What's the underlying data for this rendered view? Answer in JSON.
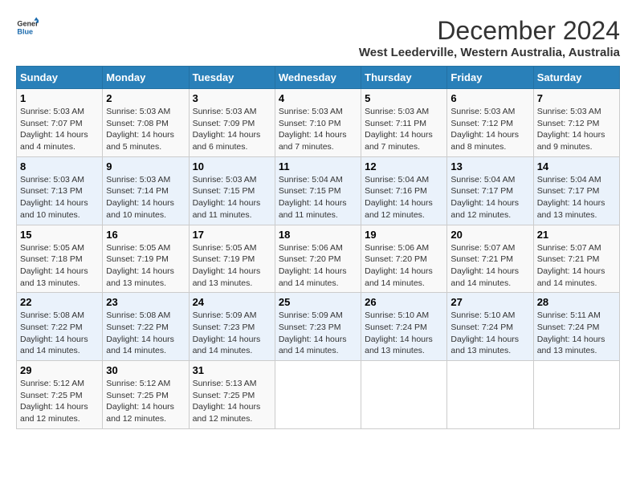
{
  "logo": {
    "line1": "General",
    "line2": "Blue"
  },
  "title": "December 2024",
  "subtitle": "West Leederville, Western Australia, Australia",
  "days_of_week": [
    "Sunday",
    "Monday",
    "Tuesday",
    "Wednesday",
    "Thursday",
    "Friday",
    "Saturday"
  ],
  "weeks": [
    [
      {
        "day": "1",
        "sunrise": "5:03 AM",
        "sunset": "7:07 PM",
        "daylight": "14 hours and 4 minutes."
      },
      {
        "day": "2",
        "sunrise": "5:03 AM",
        "sunset": "7:08 PM",
        "daylight": "14 hours and 5 minutes."
      },
      {
        "day": "3",
        "sunrise": "5:03 AM",
        "sunset": "7:09 PM",
        "daylight": "14 hours and 6 minutes."
      },
      {
        "day": "4",
        "sunrise": "5:03 AM",
        "sunset": "7:10 PM",
        "daylight": "14 hours and 7 minutes."
      },
      {
        "day": "5",
        "sunrise": "5:03 AM",
        "sunset": "7:11 PM",
        "daylight": "14 hours and 7 minutes."
      },
      {
        "day": "6",
        "sunrise": "5:03 AM",
        "sunset": "7:12 PM",
        "daylight": "14 hours and 8 minutes."
      },
      {
        "day": "7",
        "sunrise": "5:03 AM",
        "sunset": "7:12 PM",
        "daylight": "14 hours and 9 minutes."
      }
    ],
    [
      {
        "day": "8",
        "sunrise": "5:03 AM",
        "sunset": "7:13 PM",
        "daylight": "14 hours and 10 minutes."
      },
      {
        "day": "9",
        "sunrise": "5:03 AM",
        "sunset": "7:14 PM",
        "daylight": "14 hours and 10 minutes."
      },
      {
        "day": "10",
        "sunrise": "5:03 AM",
        "sunset": "7:15 PM",
        "daylight": "14 hours and 11 minutes."
      },
      {
        "day": "11",
        "sunrise": "5:04 AM",
        "sunset": "7:15 PM",
        "daylight": "14 hours and 11 minutes."
      },
      {
        "day": "12",
        "sunrise": "5:04 AM",
        "sunset": "7:16 PM",
        "daylight": "14 hours and 12 minutes."
      },
      {
        "day": "13",
        "sunrise": "5:04 AM",
        "sunset": "7:17 PM",
        "daylight": "14 hours and 12 minutes."
      },
      {
        "day": "14",
        "sunrise": "5:04 AM",
        "sunset": "7:17 PM",
        "daylight": "14 hours and 13 minutes."
      }
    ],
    [
      {
        "day": "15",
        "sunrise": "5:05 AM",
        "sunset": "7:18 PM",
        "daylight": "14 hours and 13 minutes."
      },
      {
        "day": "16",
        "sunrise": "5:05 AM",
        "sunset": "7:19 PM",
        "daylight": "14 hours and 13 minutes."
      },
      {
        "day": "17",
        "sunrise": "5:05 AM",
        "sunset": "7:19 PM",
        "daylight": "14 hours and 13 minutes."
      },
      {
        "day": "18",
        "sunrise": "5:06 AM",
        "sunset": "7:20 PM",
        "daylight": "14 hours and 14 minutes."
      },
      {
        "day": "19",
        "sunrise": "5:06 AM",
        "sunset": "7:20 PM",
        "daylight": "14 hours and 14 minutes."
      },
      {
        "day": "20",
        "sunrise": "5:07 AM",
        "sunset": "7:21 PM",
        "daylight": "14 hours and 14 minutes."
      },
      {
        "day": "21",
        "sunrise": "5:07 AM",
        "sunset": "7:21 PM",
        "daylight": "14 hours and 14 minutes."
      }
    ],
    [
      {
        "day": "22",
        "sunrise": "5:08 AM",
        "sunset": "7:22 PM",
        "daylight": "14 hours and 14 minutes."
      },
      {
        "day": "23",
        "sunrise": "5:08 AM",
        "sunset": "7:22 PM",
        "daylight": "14 hours and 14 minutes."
      },
      {
        "day": "24",
        "sunrise": "5:09 AM",
        "sunset": "7:23 PM",
        "daylight": "14 hours and 14 minutes."
      },
      {
        "day": "25",
        "sunrise": "5:09 AM",
        "sunset": "7:23 PM",
        "daylight": "14 hours and 14 minutes."
      },
      {
        "day": "26",
        "sunrise": "5:10 AM",
        "sunset": "7:24 PM",
        "daylight": "14 hours and 13 minutes."
      },
      {
        "day": "27",
        "sunrise": "5:10 AM",
        "sunset": "7:24 PM",
        "daylight": "14 hours and 13 minutes."
      },
      {
        "day": "28",
        "sunrise": "5:11 AM",
        "sunset": "7:24 PM",
        "daylight": "14 hours and 13 minutes."
      }
    ],
    [
      {
        "day": "29",
        "sunrise": "5:12 AM",
        "sunset": "7:25 PM",
        "daylight": "14 hours and 12 minutes."
      },
      {
        "day": "30",
        "sunrise": "5:12 AM",
        "sunset": "7:25 PM",
        "daylight": "14 hours and 12 minutes."
      },
      {
        "day": "31",
        "sunrise": "5:13 AM",
        "sunset": "7:25 PM",
        "daylight": "14 hours and 12 minutes."
      },
      null,
      null,
      null,
      null
    ]
  ],
  "labels": {
    "sunrise": "Sunrise:",
    "sunset": "Sunset:",
    "daylight": "Daylight:"
  }
}
